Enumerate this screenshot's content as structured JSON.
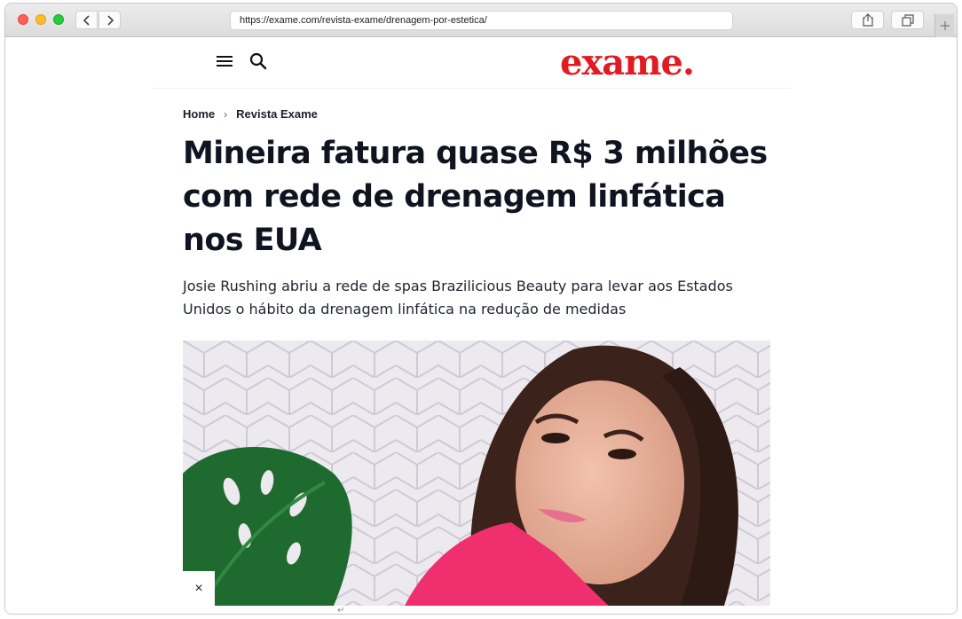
{
  "browser": {
    "url": "https://exame.com/revista-exame/drenagem-por-estetica/",
    "icons": {
      "back": "chevron-left-icon",
      "forward": "chevron-right-icon",
      "share": "share-icon",
      "tabs": "tabs-icon",
      "new_tab": "plus-icon"
    }
  },
  "header": {
    "logo": "exame.",
    "brand_color": "#e11b22",
    "icons": {
      "menu": "hamburger-menu-icon",
      "search": "search-icon"
    }
  },
  "breadcrumb": {
    "home": "Home",
    "separator": "›",
    "section": "Revista Exame"
  },
  "article": {
    "title": "Mineira fatura quase R$ 3 milhões com rede de drenagem linfática nos EUA",
    "subtitle": "Josie Rushing abriu a rede de spas Brazilicious Beauty para levar aos Estados Unidos o hábito da drenagem linfática na redução de medidas"
  },
  "overlay": {
    "close_label": "×",
    "scroll_hint": "↵"
  }
}
